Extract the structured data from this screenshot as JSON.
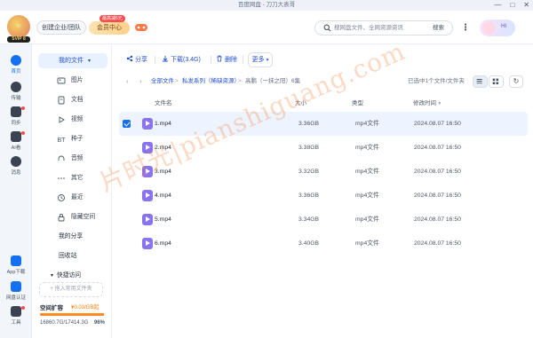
{
  "window": {
    "title": "百度网盘 - 刀刀大表哥"
  },
  "header": {
    "vip_badge": "SVIP 8",
    "enterprise_label": "创建企业/团队",
    "member_center_label": "会员中心",
    "promo_tag": "最高减6元",
    "search_placeholder": "搜网盘文件、全网资源资讯",
    "search_button": "搜索",
    "assistant_label": "Hi"
  },
  "leftrail": {
    "items": [
      {
        "label": "首页",
        "icon": "home-icon",
        "active": true
      },
      {
        "label": "传输",
        "icon": "transfer-icon",
        "active": false
      },
      {
        "label": "同步",
        "icon": "sync-icon",
        "active": false
      },
      {
        "label": "AI看",
        "icon": "ai-icon",
        "active": false
      },
      {
        "label": "消息",
        "icon": "message-icon",
        "active": false
      }
    ],
    "bottom_items": [
      {
        "label": "App下载",
        "icon": "phone-icon"
      },
      {
        "label": "网盘认证",
        "icon": "verify-icon"
      },
      {
        "label": "工具",
        "icon": "tools-icon"
      }
    ]
  },
  "sidebar": {
    "my_files": "我的文件",
    "categories": [
      {
        "label": "图片",
        "icon": "image-icon"
      },
      {
        "label": "文档",
        "icon": "document-icon"
      },
      {
        "label": "视频",
        "icon": "video-icon"
      },
      {
        "label": "种子",
        "icon": "torrent-icon"
      },
      {
        "label": "音频",
        "icon": "audio-icon"
      },
      {
        "label": "其它",
        "icon": "other-icon"
      },
      {
        "label": "最近",
        "icon": "recent-icon"
      },
      {
        "label": "隐藏空间",
        "icon": "lock-icon"
      }
    ],
    "my_share": "我的分享",
    "recycle_bin": "回收站",
    "quick_access": "快捷访问",
    "add_quick_access": "+ 拖入常用文件夹",
    "space_label": "空间扩容",
    "space_promo": "¥0.03/GB起",
    "space_usage": "16860.7G/17414.3G",
    "space_percent": "96%",
    "space_fraction": 0.968
  },
  "toolbar": {
    "share": "分享",
    "download": "下载(3.4G)",
    "delete": "删除",
    "more": "更多"
  },
  "breadcrumb": {
    "all_files": "全部文件",
    "folder": "私发系列（稀缺资源）",
    "current": "高鹏（一抹之阳）6集"
  },
  "selection_status": "已选中1个文件/文件夹",
  "table": {
    "headers": {
      "name": "文件名",
      "size": "大小",
      "type": "类型",
      "modified": "修改时间"
    },
    "rows": [
      {
        "name": "1.mp4",
        "size": "3.36GB",
        "type": "mp4文件",
        "modified": "2024.08.07 16:50",
        "selected": true
      },
      {
        "name": "2.mp4",
        "size": "3.38GB",
        "type": "mp4文件",
        "modified": "2024.08.07 16:50",
        "selected": false
      },
      {
        "name": "3.mp4",
        "size": "3.32GB",
        "type": "mp4文件",
        "modified": "2024.08.07 16:50",
        "selected": false
      },
      {
        "name": "4.mp4",
        "size": "3.36GB",
        "type": "mp4文件",
        "modified": "2024.08.07 16:50",
        "selected": false
      },
      {
        "name": "5.mp4",
        "size": "3.34GB",
        "type": "mp4文件",
        "modified": "2024.08.07 16:50",
        "selected": false
      },
      {
        "name": "6.mp4",
        "size": "3.40GB",
        "type": "mp4文件",
        "modified": "2024.08.07 16:50",
        "selected": false
      }
    ]
  },
  "watermark": "片时光|pianshiguang.com",
  "colors": {
    "accent": "#1570ef",
    "brand_blue": "#1f4fd1",
    "video_icon": "#8a73f0",
    "storage_bar": "#ff8a1f"
  }
}
